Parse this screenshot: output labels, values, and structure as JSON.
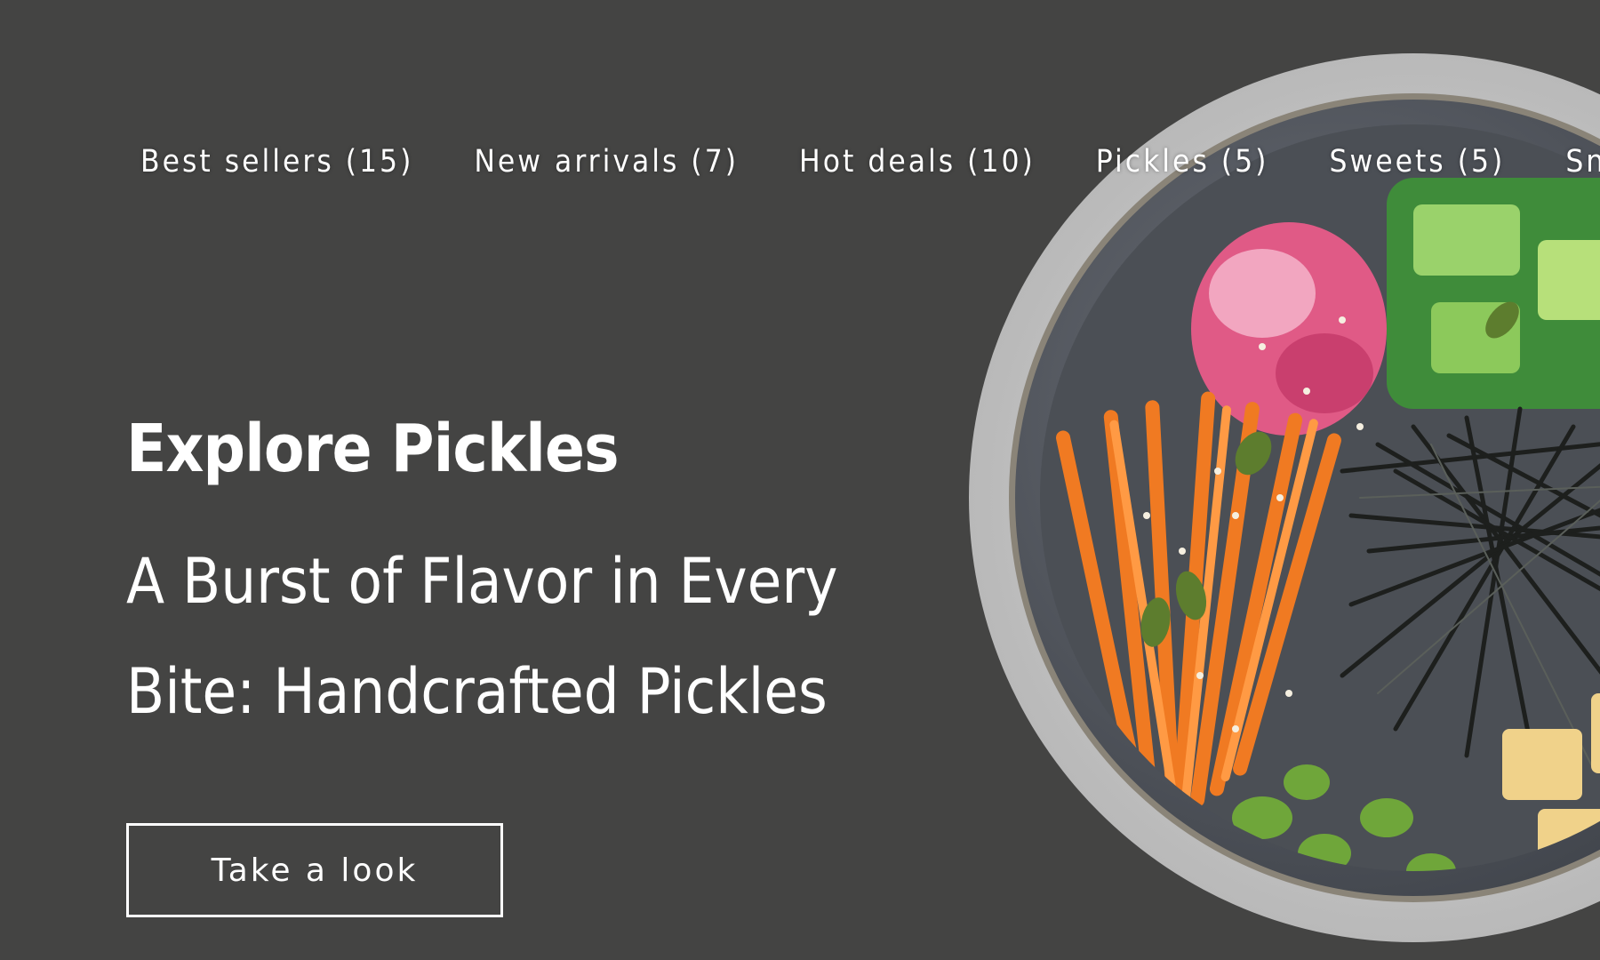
{
  "nav": {
    "categories": [
      {
        "label": "Best sellers (15)"
      },
      {
        "label": "New arrivals (7)"
      },
      {
        "label": "Hot deals (10)"
      },
      {
        "label": "Pickles (5)"
      },
      {
        "label": "Sweets (5)"
      },
      {
        "label": "Snacks"
      }
    ]
  },
  "hero": {
    "title": "Explore Pickles",
    "subtitle": "A Burst of Flavor in Every Bite: Handcrafted Pickles",
    "cta_label": "Take a look"
  },
  "colors": {
    "background": "#444443",
    "text": "#ffffff"
  }
}
